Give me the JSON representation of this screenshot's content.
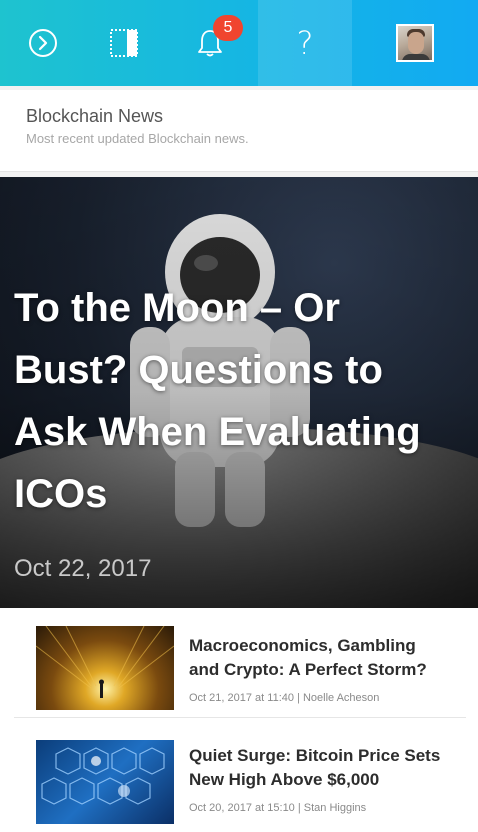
{
  "topbar": {
    "icons": [
      "arrow-circle-right-icon",
      "sidebar-panel-icon",
      "bell-icon",
      "question-icon",
      "user-avatar"
    ],
    "notification_count": "5",
    "help_glyph": "?",
    "colors": {
      "gradient_start": "#1ec3cf",
      "gradient_end": "#12aaf2",
      "badge": "#f0452f"
    }
  },
  "section": {
    "title": "Blockchain News",
    "subtitle": "Most recent updated Blockchain news."
  },
  "hero": {
    "title": "To the Moon – Or Bust? Questions to Ask When Evaluating ICOs",
    "date": "Oct 22, 2017"
  },
  "articles": [
    {
      "title": "Macroeconomics, Gambling and Crypto: A Perfect Storm?",
      "meta": "Oct 21, 2017 at 11:40 | Noelle Acheson"
    },
    {
      "title": "Quiet Surge: Bitcoin Price Sets New High Above $6,000",
      "meta": "Oct 20, 2017 at 15:10 | Stan Higgins"
    }
  ]
}
